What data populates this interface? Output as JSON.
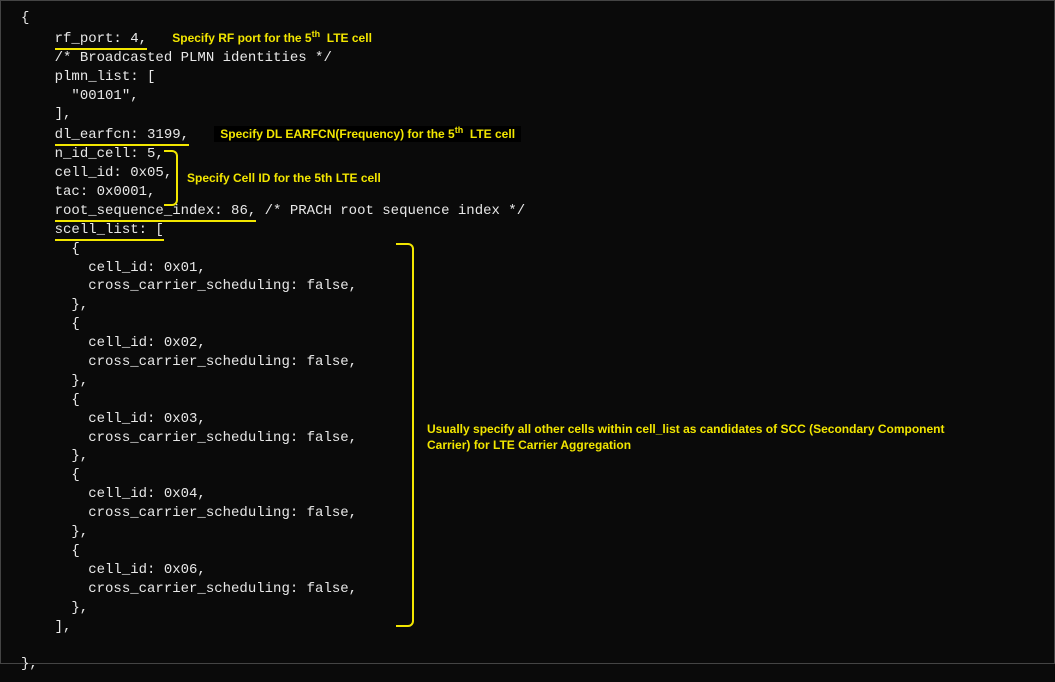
{
  "code": {
    "open_brace": "{",
    "rf_port": "rf_port: 4,",
    "comment_plmn": "/* Broadcasted PLMN identities */",
    "plmn_list_open": "plmn_list: [",
    "plmn_value": "\"00101\",",
    "plmn_list_close": "],",
    "dl_earfcn": "dl_earfcn: 3199,",
    "n_id_cell": "n_id_cell: 5,",
    "cell_id": "cell_id: 0x05,",
    "tac": "tac: 0x0001,",
    "root_seq": "root_sequence_index: 86,",
    "root_seq_comment": "/* PRACH root sequence index */",
    "scell_open": "scell_list: [",
    "scell_items": [
      {
        "cell_id": "cell_id: 0x01,",
        "ccs": "cross_carrier_scheduling: false,"
      },
      {
        "cell_id": "cell_id: 0x02,",
        "ccs": "cross_carrier_scheduling: false,"
      },
      {
        "cell_id": "cell_id: 0x03,",
        "ccs": "cross_carrier_scheduling: false,"
      },
      {
        "cell_id": "cell_id: 0x04,",
        "ccs": "cross_carrier_scheduling: false,"
      },
      {
        "cell_id": "cell_id: 0x06,",
        "ccs": "cross_carrier_scheduling: false,"
      }
    ],
    "item_open": "{",
    "item_close": "},",
    "scell_close": "],",
    "close_brace": "},"
  },
  "annotations": {
    "rf_port_a": "Specify RF port for the 5",
    "rf_port_b": "  LTE cell",
    "dl_earfcn_a": "Specify DL EARFCN(Frequency) for the 5",
    "dl_earfcn_b": "  LTE cell",
    "cell_id_a": "Specify Cell ID for the 5",
    "cell_id_b": "  LTE cell",
    "scc": "Usually specify all other cells within cell_list as candidates of SCC (Secondary Component Carrier) for LTE Carrier Aggregation",
    "th": "th"
  }
}
